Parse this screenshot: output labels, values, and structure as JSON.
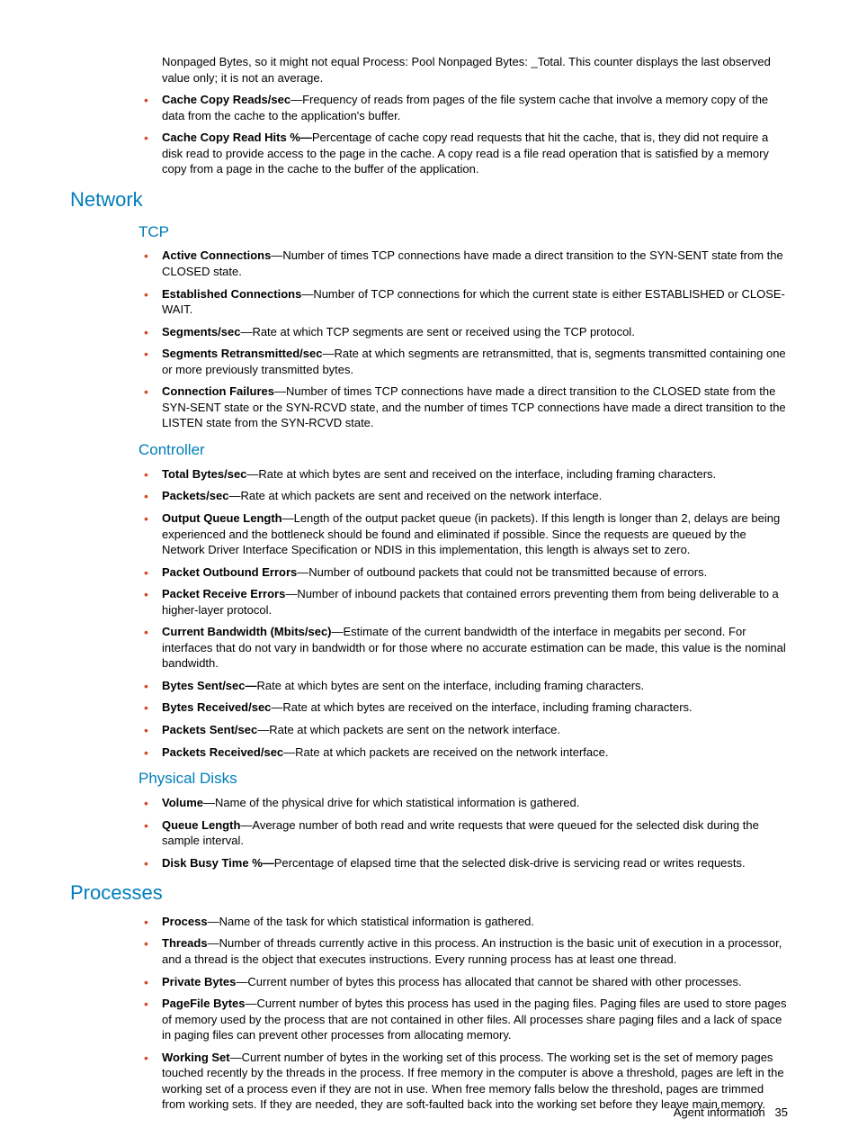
{
  "intro": {
    "cont": "Nonpaged Bytes, so it might not equal Process: Pool Nonpaged Bytes: _Total.  This counter displays the last observed value only; it is not an average.",
    "items": [
      {
        "term": "Cache Copy Reads/sec",
        "sep": "—",
        "desc": "Frequency of reads from pages of the file system cache that involve a memory copy of the data from the cache to the application's buffer."
      },
      {
        "term": "Cache Copy Read Hits %—",
        "sep": "",
        "desc": "Percentage of cache copy read requests that hit the cache, that is, they did not require a disk read to provide access to the page in the cache. A copy read is a file read operation that is satisfied by a memory copy from a page in the cache to the buffer of the application."
      }
    ]
  },
  "network": {
    "heading": "Network",
    "tcp": {
      "heading": "TCP",
      "items": [
        {
          "term": "Active Connections",
          "sep": "—",
          "desc": "Number of times TCP connections have made a direct transition to the SYN-SENT state from the CLOSED state."
        },
        {
          "term": "Established Connections",
          "sep": "—",
          "desc": "Number of TCP connections for which the current state is either ESTABLISHED or CLOSE-WAIT."
        },
        {
          "term": "Segments/sec",
          "sep": "—",
          "desc": "Rate at which TCP segments are sent or received using the TCP protocol."
        },
        {
          "term": "Segments Retransmitted/sec",
          "sep": "—",
          "desc": "Rate at which segments are retransmitted, that is, segments transmitted containing one or more previously transmitted bytes."
        },
        {
          "term": "Connection Failures",
          "sep": "—",
          "desc": "Number of times TCP connections have made a direct transition to the CLOSED state from the SYN-SENT state or the SYN-RCVD state, and the number of times TCP connections have made a direct transition to the LISTEN state from the SYN-RCVD state."
        }
      ]
    },
    "controller": {
      "heading": "Controller",
      "items": [
        {
          "term": "Total Bytes/sec",
          "sep": "—",
          "desc": "Rate at which bytes are sent and received on the interface, including framing characters."
        },
        {
          "term": "Packets/sec",
          "sep": "—",
          "desc": "Rate at which packets are sent and received on the network interface."
        },
        {
          "term": "Output Queue Length",
          "sep": "—",
          "desc": "Length of the output packet queue (in packets). If this length is longer than 2, delays are being experienced and the bottleneck should be found and eliminated if possible. Since the requests are queued by the Network Driver Interface Specification or NDIS in this implementation, this length is always set to zero."
        },
        {
          "term": "Packet Outbound Errors",
          "sep": "—",
          "desc": "Number of outbound packets that could not be transmitted because of errors."
        },
        {
          "term": "Packet Receive Errors",
          "sep": "—",
          "desc": "Number of inbound packets that contained errors preventing them from being deliverable to a higher-layer protocol."
        },
        {
          "term": "Current Bandwidth (Mbits/sec)",
          "sep": "—",
          "desc": "Estimate of the current bandwidth of the interface in megabits per second. For interfaces that do not vary in bandwidth or for those where no accurate estimation can be made, this value is the nominal bandwidth."
        },
        {
          "term": "Bytes Sent/sec—",
          "sep": "",
          "desc": "Rate at which bytes are sent on the interface, including framing characters."
        },
        {
          "term": "Bytes Received/sec",
          "sep": "—",
          "desc": "Rate at which bytes are received on the interface, including framing characters."
        },
        {
          "term": "Packets Sent/sec",
          "sep": "—",
          "desc": "Rate at which packets are sent on the network interface."
        },
        {
          "term": "Packets Received/sec",
          "sep": "—",
          "desc": "Rate at which packets are received on the network interface."
        }
      ]
    },
    "physicaldisks": {
      "heading": "Physical Disks",
      "items": [
        {
          "term": "Volume",
          "sep": "—",
          "desc": "Name of the physical drive for which statistical information is gathered."
        },
        {
          "term": "Queue Length",
          "sep": "—",
          "desc": "Average number of both read and write requests that were queued for the selected disk during the sample interval."
        },
        {
          "term": "Disk Busy Time %—",
          "sep": "",
          "desc": "Percentage of elapsed time that the selected disk-drive is servicing read or writes requests."
        }
      ]
    }
  },
  "processes": {
    "heading": "Processes",
    "items": [
      {
        "term": "Process",
        "sep": "—",
        "desc": "Name of the task for which statistical information is gathered."
      },
      {
        "term": "Threads",
        "sep": "—",
        "desc": "Number of threads currently active in this process. An instruction is the basic unit of execution in a processor, and a thread is the object that executes instructions. Every running process has at least one thread."
      },
      {
        "term": "Private Bytes",
        "sep": "—",
        "desc": "Current number of bytes this process has allocated that cannot be shared with other processes."
      },
      {
        "term": "PageFile Bytes",
        "sep": "—",
        "desc": "Current number of bytes this process has used in the paging files. Paging files are used to store pages of memory used by the process that are not contained in other files. All processes share paging files and a lack of space in paging files can prevent other processes from allocating memory."
      },
      {
        "term": "Working Set",
        "sep": "—",
        "desc": "Current number of bytes in the working set of this process. The working set is the set of memory pages touched recently by the threads in the process. If free memory in the computer is above a threshold, pages are left in the working set of a process even if they are not in use. When free memory falls below the threshold, pages are trimmed from working sets. If they are needed, they are soft-faulted back into the working set before they leave main memory."
      }
    ]
  },
  "footer": {
    "label": "Agent information",
    "pagenum": "35"
  }
}
